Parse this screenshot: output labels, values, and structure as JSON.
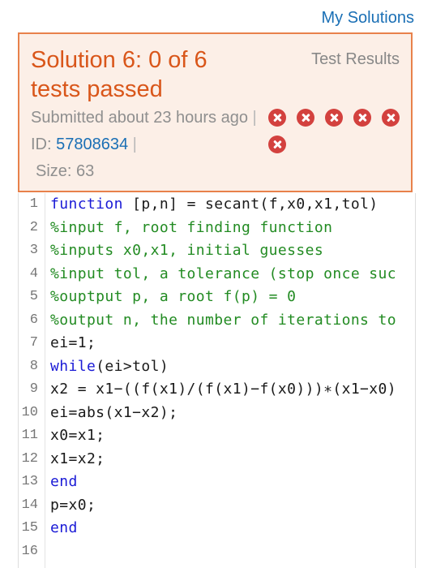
{
  "header": {
    "my_solutions_link": "My Solutions"
  },
  "solution": {
    "title": "Solution 6: 0 of 6 tests passed",
    "test_results_label": "Test Results",
    "submitted_text": "Submitted about 23 hours ago",
    "separator": "|",
    "id_label": "ID:",
    "id_value": "57808634",
    "size_text": "Size: 63",
    "test_results": [
      "fail",
      "fail",
      "fail",
      "fail",
      "fail",
      "fail"
    ]
  },
  "code": {
    "lines": [
      {
        "num": "1",
        "kw": "function",
        "rest": " [p,n] = secant(f,x0,x1,tol)"
      },
      {
        "num": "2",
        "comment": "%input f, root finding function"
      },
      {
        "num": "3",
        "comment": "%inputs x0,x1, initial guesses"
      },
      {
        "num": "4",
        "comment": "%input tol, a tolerance (stop once suc"
      },
      {
        "num": "5",
        "comment": "%ouptput p, a root f(p) = 0"
      },
      {
        "num": "6",
        "comment": "%output n, the number of iterations to"
      },
      {
        "num": "7",
        "text": "ei=1;"
      },
      {
        "num": "8",
        "kw": "while",
        "rest": "(ei>tol)"
      },
      {
        "num": "9",
        "text": "x2 = x1−((f(x1)/(f(x1)−f(x0)))∗(x1−x0)"
      },
      {
        "num": "10",
        "text": "ei=abs(x1−x2);"
      },
      {
        "num": "11",
        "text": "x0=x1;"
      },
      {
        "num": "12",
        "text": "x1=x2;"
      },
      {
        "num": "13",
        "kw": "end"
      },
      {
        "num": "14",
        "text": "p=x0;"
      },
      {
        "num": "15",
        "kw": "end"
      },
      {
        "num": "16",
        "text": ""
      }
    ]
  }
}
